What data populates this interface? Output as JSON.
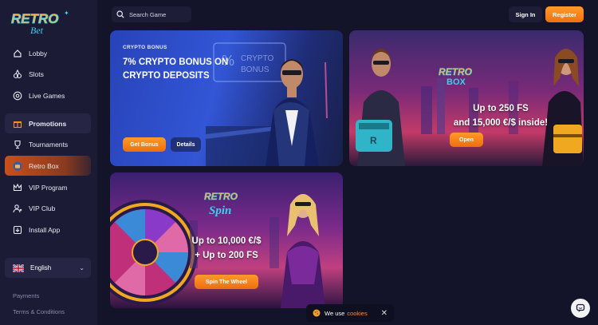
{
  "brand": {
    "logo_top": "RETRO",
    "logo_bottom": "Bet"
  },
  "colors": {
    "accent": "#f07f14",
    "sidebar_bg": "#1b1b36",
    "page_bg": "#13132a"
  },
  "sidebar": {
    "items": [
      {
        "label": "Lobby",
        "icon": "home-icon"
      },
      {
        "label": "Slots",
        "icon": "slots-icon"
      },
      {
        "label": "Live Games",
        "icon": "live-games-icon"
      },
      {
        "label": "Promotions",
        "icon": "gift-icon"
      },
      {
        "label": "Tournaments",
        "icon": "trophy-icon"
      },
      {
        "label": "Retro Box",
        "icon": "retro-box-icon"
      },
      {
        "label": "VIP Program",
        "icon": "crown-icon"
      },
      {
        "label": "VIP Club",
        "icon": "users-icon"
      },
      {
        "label": "Install App",
        "icon": "download-icon"
      }
    ],
    "language": "English",
    "footer_links": [
      "Payments",
      "Terms & Conditions"
    ]
  },
  "header": {
    "search_placeholder": "Search Game",
    "signin": "Sign In",
    "register": "Register"
  },
  "promos": {
    "crypto": {
      "eyebrow": "CRYPTO BONUS",
      "title": "7% CRYPTO BONUS ON CRYPTO DEPOSITS",
      "art_text": "% CRYPTO BONUS",
      "cta": "Get Bonus",
      "details": "Details"
    },
    "retro_box": {
      "logo_top": "RETRO",
      "logo_bottom": "BOX",
      "line1": "Up to 250 FS",
      "line2": "and 15,000 €/$ inside!",
      "cta": "Open"
    },
    "retro_spin": {
      "logo_top": "RETRO",
      "logo_bottom": "Spin",
      "line1": "Up to 10,000 €/$",
      "line2": "+ Up to 200 FS",
      "cta": "Spin The Wheel"
    }
  },
  "cookie": {
    "text": "We use",
    "link": "cookies"
  }
}
